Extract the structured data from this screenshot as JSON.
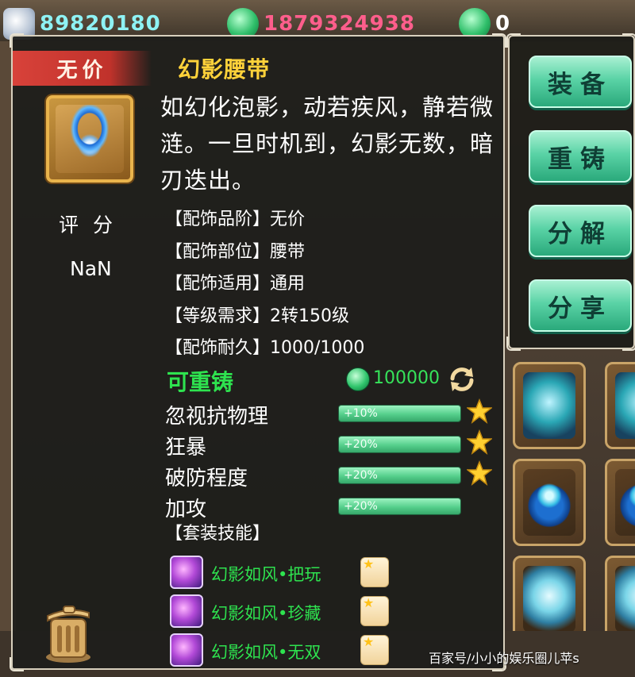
{
  "resources": {
    "silver": "89820180",
    "jade_bound": "1879324938",
    "jade": "0"
  },
  "tooltip": {
    "grade_badge": "无价",
    "item_name": "幻影腰带",
    "description": "如幻化泡影，动若疾风，静若微涟。一旦时机到，幻影无数，暗刃迭出。",
    "score_label": "评分",
    "score_value": "NaN",
    "properties": [
      "【配饰品阶】无价",
      "【配饰部位】腰带",
      "【配饰适用】通用",
      "【等级需求】2转150级",
      "【配饰耐久】1000/1000"
    ],
    "reforge": {
      "label": "可重铸",
      "cost": "100000"
    },
    "attributes": [
      {
        "name": "忽视抗物理",
        "bonus": "+10%",
        "starred": true
      },
      {
        "name": "狂暴",
        "bonus": "+20%",
        "starred": true
      },
      {
        "name": "破防程度",
        "bonus": "+20%",
        "starred": true
      },
      {
        "name": "加攻",
        "bonus": "+20%",
        "starred": false
      }
    ],
    "set_skills_label": "【套装技能】",
    "set_skills": [
      "幻影如风•把玩",
      "幻影如风•珍藏",
      "幻影如风•无双"
    ]
  },
  "actions": {
    "equip": "装备",
    "reforge": "重铸",
    "decompose": "分解",
    "share": "分享"
  },
  "watermark": "百家号/小小的娱乐圈儿苹s",
  "colors": {
    "item_name": "#ffd23a",
    "grade_badge": "#d8423a",
    "green_text": "#2ee34f",
    "button_green": "#5ad3a6"
  }
}
